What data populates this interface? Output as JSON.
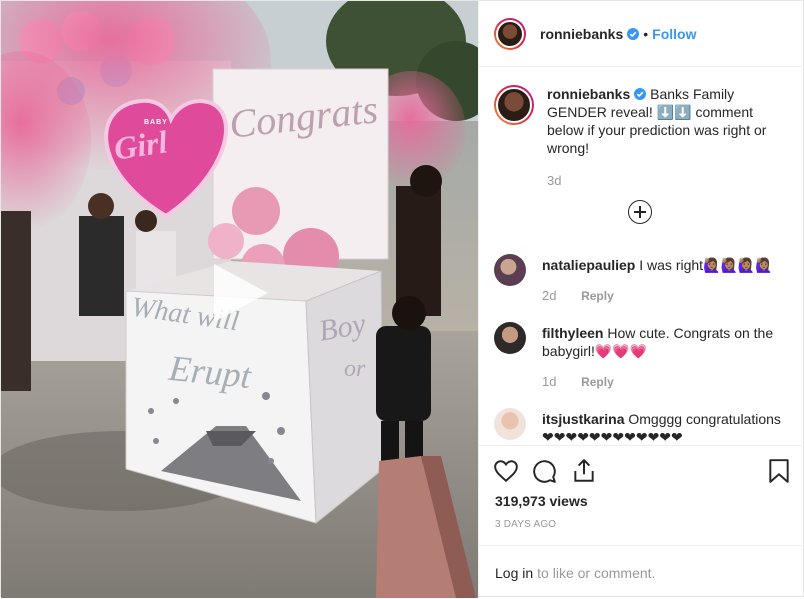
{
  "post": {
    "username": "ronniebanks",
    "separator": "•",
    "follow_label": "Follow",
    "caption": "Banks Family GENDER reveal! ⬇️⬇️ comment below if your prediction was right or wrong!",
    "caption_age": "3d",
    "video_text": {
      "balloon": "Girl",
      "balloon_small": "BABY",
      "board": "Congrats",
      "box_front_1": "What will",
      "box_front_2": "Erupt",
      "box_side_1": "Boy",
      "box_side_2": "or"
    }
  },
  "comments": [
    {
      "username": "nataliepauliep",
      "text": "I was right🙋🏽‍♀️🙋🏽‍♀️🙋🏽‍♀️🙋🏽‍♀️",
      "age": "2d",
      "reply_label": "Reply"
    },
    {
      "username": "filthyleen",
      "text": "How cute. Congrats on the babygirl!💗💗💗",
      "age": "1d",
      "reply_label": "Reply"
    },
    {
      "username": "itsjustkarina",
      "text": "Omgggg congratulations ❤❤❤❤❤❤❤❤❤❤❤❤",
      "age": "",
      "reply_label": ""
    }
  ],
  "stats": {
    "views": "319,973 views",
    "date": "3 DAYS AGO"
  },
  "login_bar": {
    "login_label": "Log in",
    "rest": "to like or comment."
  },
  "icons": [
    "play-icon",
    "verified-badge-icon",
    "plus-circle-icon",
    "heart-icon",
    "comment-icon",
    "share-icon",
    "bookmark-icon"
  ],
  "colors": {
    "link_blue": "#3897f0",
    "verified_blue": "#3897f0",
    "muted_text": "#999999"
  }
}
